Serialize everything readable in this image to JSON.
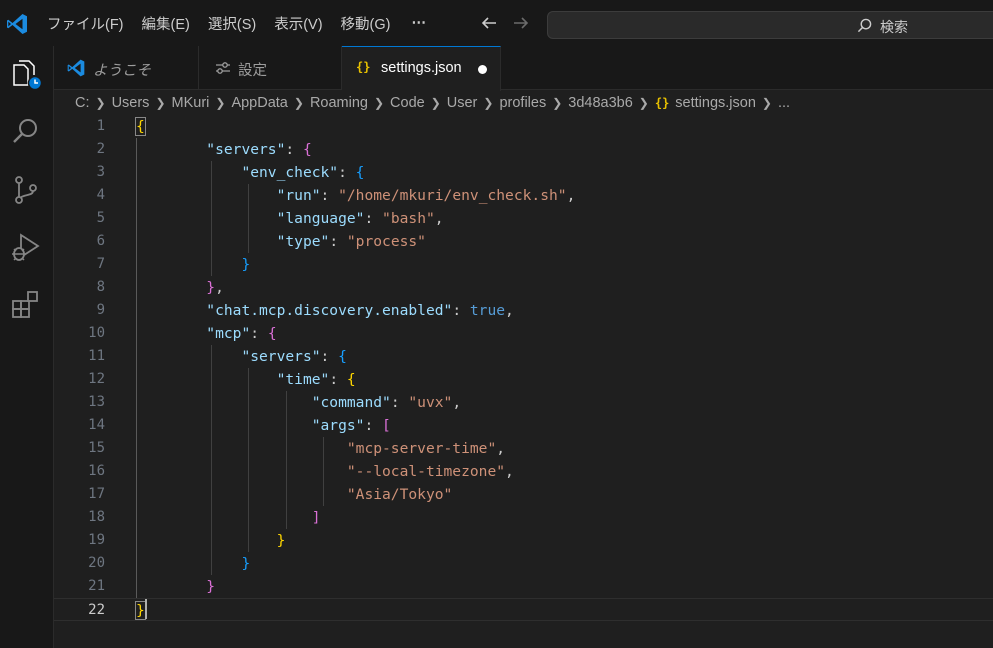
{
  "titlebar": {
    "menus": [
      "ファイル(F)",
      "編集(E)",
      "選択(S)",
      "表示(V)",
      "移動(G)",
      "⋯"
    ],
    "search_label": "検索"
  },
  "tabs": [
    {
      "label": "ようこそ",
      "icon": "vscode-logo-icon",
      "active": false
    },
    {
      "label": "設定",
      "icon": "settings-sliders-icon",
      "active": false
    },
    {
      "label": "settings.json",
      "icon": "json-braces-icon",
      "active": true,
      "dirty": true
    }
  ],
  "breadcrumb": [
    "C:",
    "Users",
    "MKuri",
    "AppData",
    "Roaming",
    "Code",
    "User",
    "profiles",
    "3d48a3b6",
    "settings.json",
    "..."
  ],
  "activity_icons": [
    "explorer-icon",
    "search-icon",
    "source-control-icon",
    "run-debug-icon",
    "extensions-icon"
  ],
  "editor": {
    "line_numbers": [
      "1",
      "2",
      "3",
      "4",
      "5",
      "6",
      "7",
      "8",
      "9",
      "10",
      "11",
      "12",
      "13",
      "14",
      "15",
      "16",
      "17",
      "18",
      "19",
      "20",
      "21",
      "22"
    ],
    "current_line": 22,
    "lines": [
      "{",
      "        \"servers\": {",
      "            \"env_check\": {",
      "                \"run\": \"/home/mkuri/env_check.sh\",",
      "                \"language\": \"bash\",",
      "                \"type\": \"process\"",
      "            }",
      "        },",
      "        \"chat.mcp.discovery.enabled\": true,",
      "        \"mcp\": {",
      "            \"servers\": {",
      "                \"time\": {",
      "                    \"command\": \"uvx\",",
      "                    \"args\": [",
      "                        \"mcp-server-time\",",
      "                        \"--local-timezone\",",
      "                        \"Asia/Tokyo\"",
      "                    ]",
      "                }",
      "            }",
      "        }",
      "}"
    ]
  },
  "colors": {
    "accent": "#0078d4",
    "json_key": "#9cdcfe",
    "json_string": "#ce9178",
    "json_bool": "#569cd6",
    "bracket_gold": "#ffd700",
    "bracket_magenta": "#da70d6",
    "bracket_blue": "#179fff"
  }
}
